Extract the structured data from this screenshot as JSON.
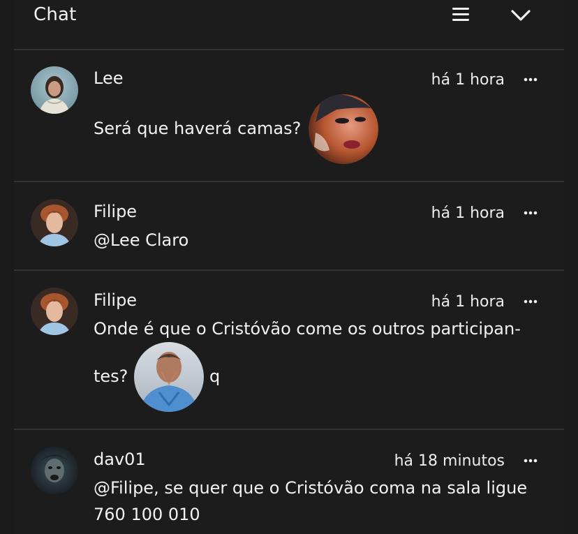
{
  "header": {
    "title": "Chat",
    "menu_icon": "hamburger-icon",
    "collapse_icon": "chevron-down-icon"
  },
  "messages": [
    {
      "author": "Lee",
      "time": "há 1 hora",
      "text": "Será que haverá camas?",
      "has_sticker": true,
      "more_icon": "ellipsis-icon"
    },
    {
      "author": "Filipe",
      "time": "há 1 hora",
      "text": "@Lee Claro",
      "has_sticker": false,
      "more_icon": "ellipsis-icon"
    },
    {
      "author": "Filipe",
      "time": "há 1 hora",
      "text_line1": "Onde é que o Cristóvão come os outros participan-",
      "text_line2": "tes?",
      "text_after_sticker": "q",
      "has_sticker": true,
      "more_icon": "ellipsis-icon"
    },
    {
      "author": "dav01",
      "time": "há 18 minutos",
      "text_line1": "@Filipe, se quer que o Cristóvão coma na sala ligue",
      "text_line2": "760 100 010",
      "has_sticker": false,
      "more_icon": "ellipsis-icon"
    }
  ],
  "colors": {
    "background": "#1a1a1a",
    "panel": "#1c1c1d",
    "divider": "#333333",
    "text": "#f2f2f2"
  }
}
